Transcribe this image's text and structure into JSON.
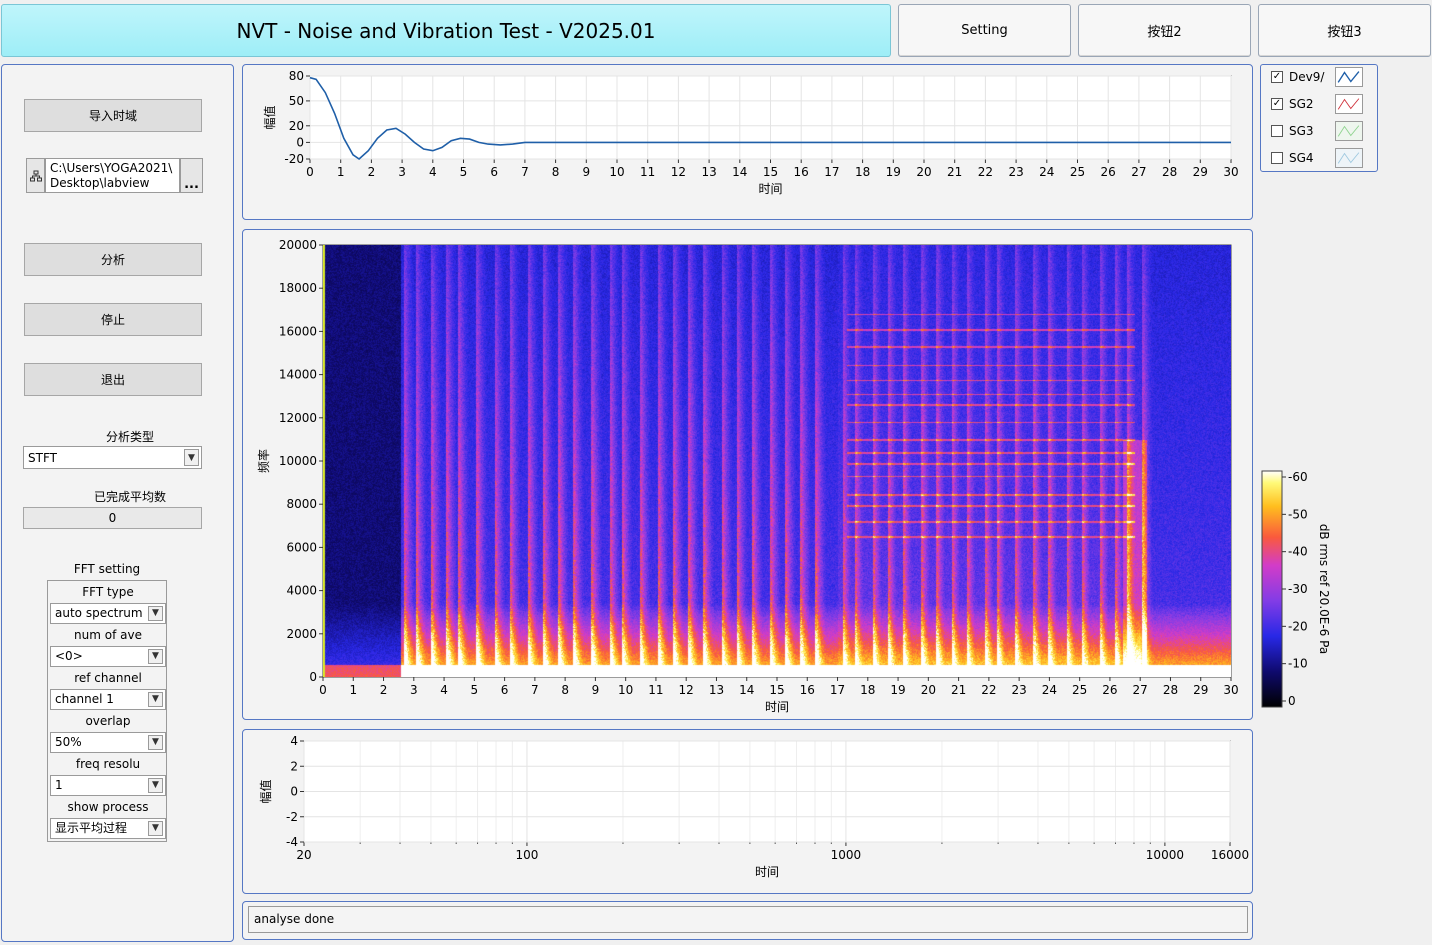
{
  "header": {
    "title": "NVT - Noise and Vibration Test - V2025.01",
    "buttons": [
      "Setting",
      "按钮2",
      "按钮3"
    ]
  },
  "left_panel": {
    "import_button": "导入时域",
    "file_path_line1": "C:\\Users\\YOGA2021\\",
    "file_path_line2": "Desktop\\labview",
    "browse_button": "...",
    "analyze_button": "分析",
    "stop_button": "停止",
    "exit_button": "退出",
    "analysis_type_label": "分析类型",
    "analysis_type_value": "STFT",
    "completed_avg_label": "已完成平均数",
    "completed_avg_value": "0",
    "fft_setting_title": "FFT setting",
    "fft_fields": [
      {
        "label": "FFT type",
        "value": "auto spectrum"
      },
      {
        "label": "num of ave",
        "value": "<0>"
      },
      {
        "label": "ref channel",
        "value": "channel 1"
      },
      {
        "label": "overlap",
        "value": "50%"
      },
      {
        "label": "freq resolu",
        "value": "1"
      },
      {
        "label": "show process",
        "value": "显示平均过程"
      }
    ]
  },
  "legend": {
    "items": [
      {
        "name": "Dev9/",
        "checked": true,
        "color": "#1f5fa8"
      },
      {
        "name": "SG2",
        "checked": true,
        "color": "#d0303a"
      },
      {
        "name": "SG3",
        "checked": false,
        "color": "#8fd48f"
      },
      {
        "name": "SG4",
        "checked": false,
        "color": "#9fc9e0"
      }
    ]
  },
  "chart_data": [
    {
      "type": "line",
      "ylabel": "幅值",
      "xlabel": "时间",
      "xlim": [
        0,
        30
      ],
      "ylim": [
        -20,
        80
      ],
      "yticks": [
        80,
        50,
        20,
        0,
        -20
      ],
      "xticks": [
        "0",
        "1",
        "2",
        "3",
        "4",
        "5",
        "6",
        "7",
        "8",
        "9",
        "10",
        "11",
        "12",
        "13",
        "14",
        "15",
        "16",
        "17",
        "18",
        "19",
        "20",
        "21",
        "22",
        "23",
        "24",
        "25",
        "26",
        "27",
        "28",
        "29",
        "30"
      ],
      "series": [
        {
          "color": "#1f5fa8",
          "x": [
            0,
            0.2,
            0.5,
            0.8,
            1.1,
            1.4,
            1.6,
            1.9,
            2.2,
            2.5,
            2.8,
            3.1,
            3.4,
            3.7,
            4.0,
            4.3,
            4.6,
            4.9,
            5.2,
            5.5,
            5.8,
            6.2,
            6.6,
            7.0,
            8,
            10,
            15,
            20,
            25,
            30
          ],
          "y": [
            78,
            76,
            60,
            35,
            5,
            -15,
            -20,
            -10,
            5,
            15,
            17,
            10,
            0,
            -8,
            -10,
            -6,
            2,
            5,
            4,
            0,
            -2,
            -3,
            -2,
            0,
            0,
            0,
            0,
            0,
            0,
            0
          ]
        }
      ]
    },
    {
      "type": "heatmap",
      "ylabel": "频率",
      "xlabel": "时间",
      "xlim": [
        0,
        30
      ],
      "ylim": [
        0,
        20000
      ],
      "yticks": [
        20000,
        18000,
        16000,
        14000,
        12000,
        10000,
        8000,
        6000,
        4000,
        2000,
        0
      ],
      "xticks": [
        "0",
        "1",
        "2",
        "3",
        "4",
        "5",
        "6",
        "7",
        "8",
        "9",
        "10",
        "11",
        "12",
        "13",
        "14",
        "15",
        "16",
        "17",
        "18",
        "19",
        "20",
        "21",
        "22",
        "23",
        "24",
        "25",
        "26",
        "27",
        "28",
        "29",
        "30"
      ],
      "colorbar": {
        "label": "dB rms ref 20.0E-6 Pa",
        "ticks": [
          -60,
          -50,
          -40,
          -30,
          -20,
          -10,
          0
        ]
      }
    },
    {
      "type": "line",
      "ylabel": "幅值",
      "xlabel": "时间",
      "xscale": "log",
      "xlim": [
        20,
        16000
      ],
      "ylim": [
        -4,
        4
      ],
      "yticks": [
        4,
        2,
        0,
        -2,
        -4
      ],
      "xticks": [
        "20",
        "100",
        "1000",
        "10000",
        "16000"
      ],
      "series": []
    }
  ],
  "status": {
    "text": "analyse done"
  }
}
